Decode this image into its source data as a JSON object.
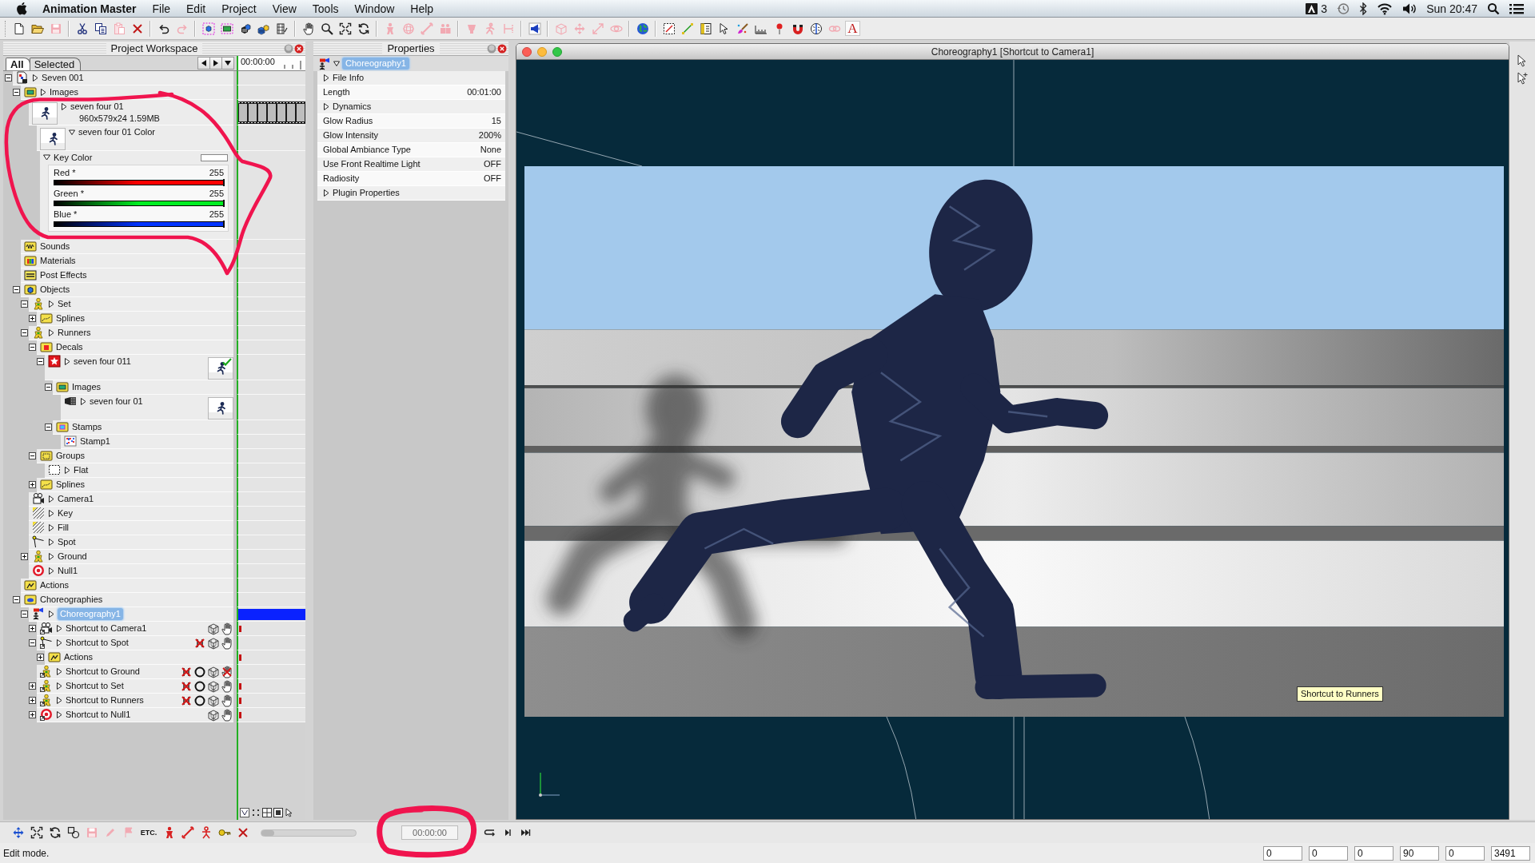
{
  "menu_bar": {
    "app": "Animation Master",
    "menus": [
      "File",
      "Edit",
      "Project",
      "View",
      "Tools",
      "Window",
      "Help"
    ],
    "badge_count": "3",
    "clock": "Sun 20:47"
  },
  "toolbar": {
    "groups": [
      [
        {
          "kind": "new",
          "enabled": true
        },
        {
          "kind": "open",
          "enabled": true
        },
        {
          "kind": "save",
          "enabled": false
        }
      ],
      [
        {
          "kind": "cut",
          "enabled": true
        },
        {
          "kind": "copy",
          "enabled": true
        },
        {
          "kind": "paste",
          "enabled": false
        },
        {
          "kind": "delete",
          "enabled": true
        }
      ],
      [
        {
          "kind": "undo",
          "enabled": true
        },
        {
          "kind": "redo",
          "enabled": false
        }
      ],
      [
        {
          "kind": "new-model",
          "enabled": true
        },
        {
          "kind": "new-image",
          "enabled": true
        },
        {
          "kind": "new-action",
          "enabled": true
        },
        {
          "kind": "new-choreography",
          "enabled": true
        },
        {
          "kind": "film",
          "enabled": true
        }
      ],
      [
        {
          "kind": "hand",
          "enabled": true
        },
        {
          "kind": "zoom",
          "enabled": true
        },
        {
          "kind": "fit",
          "enabled": true
        },
        {
          "kind": "rotate",
          "enabled": true
        }
      ],
      [
        {
          "kind": "figure",
          "enabled": false
        },
        {
          "kind": "sphere",
          "enabled": false
        },
        {
          "kind": "bone",
          "enabled": false
        },
        {
          "kind": "skin",
          "enabled": false
        }
      ],
      [
        {
          "kind": "pose",
          "enabled": false
        },
        {
          "kind": "walk",
          "enabled": false
        },
        {
          "kind": "lathe",
          "enabled": false
        }
      ],
      [
        {
          "kind": "speaker",
          "enabled": true
        }
      ],
      [
        {
          "kind": "cube",
          "enabled": false
        },
        {
          "kind": "move",
          "enabled": false
        },
        {
          "kind": "scale",
          "enabled": false
        },
        {
          "kind": "orbit",
          "enabled": false
        }
      ],
      [
        {
          "kind": "globe",
          "enabled": true
        }
      ],
      [
        {
          "kind": "bounds",
          "enabled": true
        },
        {
          "kind": "line",
          "enabled": true
        },
        {
          "kind": "panel",
          "enabled": true
        },
        {
          "kind": "pointer",
          "enabled": true
        },
        {
          "kind": "brush",
          "enabled": true
        },
        {
          "kind": "ruler",
          "enabled": true
        },
        {
          "kind": "pin",
          "enabled": true
        },
        {
          "kind": "magnet",
          "enabled": true
        },
        {
          "kind": "brain",
          "enabled": true
        },
        {
          "kind": "chain",
          "enabled": false
        },
        {
          "kind": "font",
          "label": "A",
          "enabled": true
        }
      ]
    ]
  },
  "workspace": {
    "title": "Project Workspace",
    "tabs": [
      {
        "label": "All",
        "selected": true
      },
      {
        "label": "Selected",
        "selected": false
      }
    ],
    "time": "00:00:00",
    "tree": [
      {
        "label": "Seven 001",
        "kind": "project",
        "expanded": true,
        "props_open": false,
        "selected": false,
        "children": [
          {
            "label": "Images",
            "kind": "folder-images",
            "expanded": true,
            "props_open": false,
            "selected": false,
            "children": [
              {
                "label": "seven four 01",
                "kind": "image",
                "props_open": false,
                "selected": false,
                "detail": "960x579x24 1.59MB",
                "track": {
                  "kind": "filmstrip"
                },
                "children": [
                  {
                    "label": "seven four 01 Color",
                    "kind": "image",
                    "props_open": true,
                    "selected": false,
                    "key_color": {
                      "label": "Key Color",
                      "open": true,
                      "color": "#ffffff",
                      "circled": true,
                      "channels": [
                        {
                          "name": "Red *",
                          "value": "255",
                          "level": 1,
                          "color": "#ff0000"
                        },
                        {
                          "name": "Green *",
                          "value": "255",
                          "level": 1,
                          "color": "#00ee22"
                        },
                        {
                          "name": "Blue *",
                          "value": "255",
                          "level": 1,
                          "color": "#0033ff"
                        }
                      ]
                    }
                  }
                ]
              }
            ]
          },
          {
            "label": "Sounds",
            "kind": "folder-sounds",
            "selected": false
          },
          {
            "label": "Materials",
            "kind": "folder-materials",
            "selected": false
          },
          {
            "label": "Post Effects",
            "kind": "folder-effects",
            "selected": false
          },
          {
            "label": "Objects",
            "kind": "folder-objects",
            "expanded": true,
            "selected": false,
            "children": [
              {
                "label": "Set",
                "kind": "model",
                "expanded": true,
                "props_open": false,
                "selected": false,
                "children": [
                  {
                    "label": "Splines",
                    "kind": "folder-splines",
                    "expanded": false,
                    "selected": false
                  }
                ]
              },
              {
                "label": "Runners",
                "kind": "model",
                "expanded": true,
                "props_open": false,
                "selected": false,
                "children": [
                  {
                    "label": "Decals",
                    "kind": "folder-decals",
                    "expanded": true,
                    "selected": false,
                    "children": [
                      {
                        "label": "seven four 011",
                        "kind": "decal",
                        "expanded": true,
                        "props_open": false,
                        "selected": false,
                        "preview": {
                          "checked": true
                        },
                        "children": [
                          {
                            "label": "Images",
                            "kind": "folder-images",
                            "expanded": true,
                            "selected": false,
                            "children": [
                              {
                                "label": "seven four 01",
                                "kind": "image-file",
                                "props_open": false,
                                "selected": false,
                                "preview": {
                                  "checked": false
                                }
                              }
                            ]
                          },
                          {
                            "label": "Stamps",
                            "kind": "folder-stamps",
                            "expanded": true,
                            "selected": false,
                            "children": [
                              {
                                "label": "Stamp1",
                                "kind": "stamp",
                                "selected": false
                              }
                            ]
                          }
                        ]
                      }
                    ]
                  },
                  {
                    "label": "Groups",
                    "kind": "folder-groups",
                    "expanded": true,
                    "selected": false,
                    "children": [
                      {
                        "label": "Flat",
                        "kind": "group",
                        "props_open": false,
                        "selected": false
                      }
                    ]
                  },
                  {
                    "label": "Splines",
                    "kind": "folder-splines",
                    "expanded": false,
                    "selected": false
                  }
                ]
              },
              {
                "label": "Camera1",
                "kind": "camera",
                "props_open": false,
                "selected": false
              },
              {
                "label": "Key",
                "kind": "light",
                "props_open": false,
                "selected": false
              },
              {
                "label": "Fill",
                "kind": "light",
                "props_open": false,
                "selected": false
              },
              {
                "label": "Spot",
                "kind": "spot",
                "props_open": false,
                "selected": false
              },
              {
                "label": "Ground",
                "kind": "model",
                "expanded": false,
                "props_open": false,
                "selected": false
              },
              {
                "label": "Null1",
                "kind": "null",
                "props_open": false,
                "selected": false
              }
            ]
          },
          {
            "label": "Actions",
            "kind": "folder-actions",
            "selected": false
          },
          {
            "label": "Choreographies",
            "kind": "folder-choreo",
            "expanded": true,
            "selected": false,
            "children": [
              {
                "label": "Choreography1",
                "kind": "choreography",
                "expanded": true,
                "props_open": false,
                "selected": true,
                "track": {
                  "kind": "range"
                },
                "children": [
                  {
                    "label": "Shortcut to Camera1",
                    "kind": "shortcut-camera",
                    "expanded": false,
                    "props_open": false,
                    "selected": false,
                    "track": {
                      "kind": "key"
                    },
                    "toggles": [
                      {
                        "kind": "cube",
                        "enabled": true
                      },
                      {
                        "kind": "hand",
                        "enabled": true
                      }
                    ]
                  },
                  {
                    "label": "Shortcut to Spot",
                    "kind": "shortcut-spot",
                    "expanded": true,
                    "props_open": false,
                    "selected": false,
                    "toggles": [
                      {
                        "kind": "bones",
                        "enabled": true
                      },
                      {
                        "kind": "cube",
                        "enabled": true
                      },
                      {
                        "kind": "hand",
                        "enabled": true
                      }
                    ],
                    "children": [
                      {
                        "label": "Actions",
                        "kind": "folder-actions",
                        "expanded": false,
                        "selected": false,
                        "track": {
                          "kind": "key"
                        }
                      }
                    ]
                  },
                  {
                    "label": "Shortcut to Ground",
                    "kind": "shortcut-model",
                    "props_open": false,
                    "selected": false,
                    "toggles": [
                      {
                        "kind": "bones",
                        "enabled": true
                      },
                      {
                        "kind": "ring",
                        "enabled": true
                      },
                      {
                        "kind": "cube",
                        "enabled": true
                      },
                      {
                        "kind": "hand",
                        "enabled": false
                      }
                    ]
                  },
                  {
                    "label": "Shortcut to Set",
                    "kind": "shortcut-model",
                    "expanded": false,
                    "props_open": false,
                    "selected": false,
                    "track": {
                      "kind": "key"
                    },
                    "toggles": [
                      {
                        "kind": "bones",
                        "enabled": true
                      },
                      {
                        "kind": "ring",
                        "enabled": true
                      },
                      {
                        "kind": "cube",
                        "enabled": true
                      },
                      {
                        "kind": "hand",
                        "enabled": true
                      }
                    ]
                  },
                  {
                    "label": "Shortcut to Runners",
                    "kind": "shortcut-model",
                    "expanded": false,
                    "props_open": false,
                    "selected": false,
                    "track": {
                      "kind": "key"
                    },
                    "toggles": [
                      {
                        "kind": "bones",
                        "enabled": true
                      },
                      {
                        "kind": "ring",
                        "enabled": true
                      },
                      {
                        "kind": "cube",
                        "enabled": true
                      },
                      {
                        "kind": "hand",
                        "enabled": true
                      }
                    ]
                  },
                  {
                    "label": "Shortcut to Null1",
                    "kind": "shortcut-null",
                    "expanded": false,
                    "props_open": false,
                    "selected": false,
                    "track": {
                      "kind": "key"
                    },
                    "toggles": [
                      {
                        "kind": "cube",
                        "enabled": true
                      },
                      {
                        "kind": "hand",
                        "enabled": true
                      }
                    ]
                  }
                ]
              }
            ]
          }
        ]
      }
    ]
  },
  "properties": {
    "title": "Properties",
    "object": {
      "label": "Choreography1",
      "selected": true
    },
    "rows": [
      {
        "kind": "group",
        "label": "File Info",
        "open": false
      },
      {
        "kind": "value",
        "label": "Length",
        "value": "00:01:00"
      },
      {
        "kind": "group",
        "label": "Dynamics",
        "open": false
      },
      {
        "kind": "value",
        "label": "Glow Radius",
        "value": "15"
      },
      {
        "kind": "value",
        "label": "Glow Intensity",
        "value": "200%"
      },
      {
        "kind": "value",
        "label": "Global Ambiance Type",
        "value": "None"
      },
      {
        "kind": "value",
        "label": "Use Front Realtime Light",
        "value": "OFF"
      },
      {
        "kind": "value",
        "label": "Radiosity",
        "value": "OFF"
      },
      {
        "kind": "group",
        "label": "Plugin Properties",
        "open": false
      }
    ]
  },
  "viewport": {
    "title": "Choreography1 [Shortcut to Camera1]",
    "tooltip": "Shortcut to Runners"
  },
  "bottom_bar": {
    "tools": [
      {
        "kind": "move",
        "enabled": true
      },
      {
        "kind": "fit",
        "enabled": true
      },
      {
        "kind": "rotate",
        "enabled": true
      },
      {
        "kind": "link",
        "enabled": true
      },
      {
        "kind": "save",
        "enabled": false
      },
      {
        "kind": "pen",
        "enabled": false
      },
      {
        "kind": "marker",
        "enabled": false
      },
      {
        "kind": "text",
        "label": "ETC.",
        "enabled": true
      },
      {
        "kind": "figure",
        "enabled": true
      },
      {
        "kind": "bone",
        "enabled": true
      },
      {
        "kind": "skeleton",
        "enabled": true
      },
      {
        "kind": "key",
        "enabled": true
      },
      {
        "kind": "delete",
        "enabled": true
      }
    ],
    "scrub": {
      "level": 0
    },
    "time": {
      "value": "00:00:00",
      "circled": true
    },
    "transport": [
      {
        "kind": "loop"
      },
      {
        "kind": "step"
      },
      {
        "kind": "end"
      }
    ]
  },
  "status_bar": {
    "message": "Edit mode.",
    "fields": [
      "0",
      "0",
      "0",
      "90",
      "0",
      "3491"
    ]
  }
}
